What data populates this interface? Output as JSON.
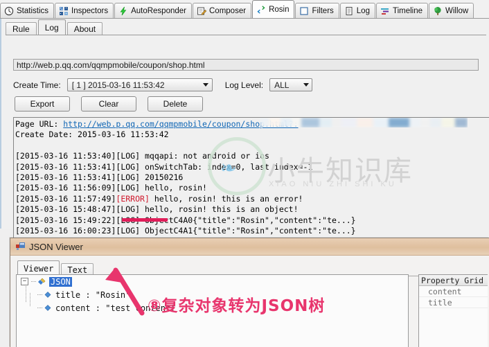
{
  "app": {
    "tabs": [
      {
        "label": "Statistics",
        "icon": "clock-icon",
        "active": false
      },
      {
        "label": "Inspectors",
        "icon": "inspectors-grid-icon",
        "active": false
      },
      {
        "label": "AutoResponder",
        "icon": "lightning-bolt-icon",
        "active": false
      },
      {
        "label": "Composer",
        "icon": "pencil-notepad-icon",
        "active": false
      },
      {
        "label": "Rosin",
        "icon": "green-swap-arrows-icon",
        "active": true
      },
      {
        "label": "Filters",
        "icon": "empty-square-icon",
        "active": false
      },
      {
        "label": "Log",
        "icon": "document-lines-icon",
        "active": false
      },
      {
        "label": "Timeline",
        "icon": "timeline-bars-icon",
        "active": false
      },
      {
        "label": "Willow",
        "icon": "green-tree-icon",
        "active": false
      }
    ]
  },
  "rosin": {
    "subtabs": [
      {
        "label": "Rule",
        "active": false
      },
      {
        "label": "Log",
        "active": true
      },
      {
        "label": "About",
        "active": false
      }
    ],
    "url_value": "http://web.p.qq.com/qqmpmobile/coupon/shop.html",
    "url_placeholder": "http://",
    "create_time_label": "Create Time:",
    "create_time_value": "[ 1 ] 2015-03-16 11:53:42",
    "log_level_label": "Log Level:",
    "log_level_value": "ALL",
    "buttons": [
      {
        "label": "Export",
        "name": "export-button"
      },
      {
        "label": "Clear",
        "name": "clear-button"
      },
      {
        "label": "Delete",
        "name": "delete-button"
      }
    ],
    "log_header": {
      "page_url_label": "Page URL:",
      "page_url_value": "http://web.p.qq.com/qqmpmobile/coupon/shop.html?:",
      "create_date_label": "Create Date:",
      "create_date_value": "2015-03-16 11:53:42"
    },
    "log_lines": [
      {
        "ts": "[2015-03-16 11:53:40]",
        "level": "[LOG]",
        "msg": "mqqapi: not android or ios",
        "is_error": false
      },
      {
        "ts": "[2015-03-16 11:53:41]",
        "level": "[LOG]",
        "msg": "onSwitchTab: index=0, last index=-1",
        "is_error": false
      },
      {
        "ts": "[2015-03-16 11:53:41]",
        "level": "[LOG]",
        "msg": "20150216",
        "is_error": false
      },
      {
        "ts": "[2015-03-16 11:56:09]",
        "level": "[LOG]",
        "msg": "hello, rosin!",
        "is_error": false
      },
      {
        "ts": "[2015-03-16 11:57:49]",
        "level": "[ERROR]",
        "msg": "hello, rosin! this is an error!",
        "is_error": true
      },
      {
        "ts": "[2015-03-16 15:48:47]",
        "level": "[LOG]",
        "msg": "hello, rosin! this is an object!",
        "is_error": false
      },
      {
        "ts": "[2015-03-16 15:49:22]",
        "level": "[LOG]",
        "msg": "ObjectC4A0{\"title\":\"Rosin\",\"content\":\"te...}",
        "is_error": false
      },
      {
        "ts": "[2015-03-16 16:00:23]",
        "level": "[LOG]",
        "msg": "ObjectC4A1{\"title\":\"Rosin\",\"content\":\"te...}",
        "is_error": false
      }
    ]
  },
  "json_viewer": {
    "window_title": "JSON Viewer",
    "tabs": [
      {
        "label": "Viewer",
        "active": true
      },
      {
        "label": "Text",
        "active": false
      }
    ],
    "tree": {
      "root_label": "JSON",
      "children": [
        {
          "label": "title : \"Rosin\""
        },
        {
          "label": "content : \"test content!"
        }
      ]
    },
    "property_grid": {
      "header": "Property Grid",
      "rows": [
        "content",
        "title"
      ]
    }
  },
  "annotation": {
    "step_text": "⑧复杂对象转为JSON树",
    "color": "#e8356d"
  },
  "watermark": {
    "cn": "小牛知识库",
    "pinyin": "XIAO NIU ZHI SHI KU"
  },
  "colors": {
    "accent": "#e8356d",
    "error": "#d01b2e",
    "link": "#1066b5",
    "selection": "#2f6fd0",
    "titlebar": "#dfbf9e"
  }
}
